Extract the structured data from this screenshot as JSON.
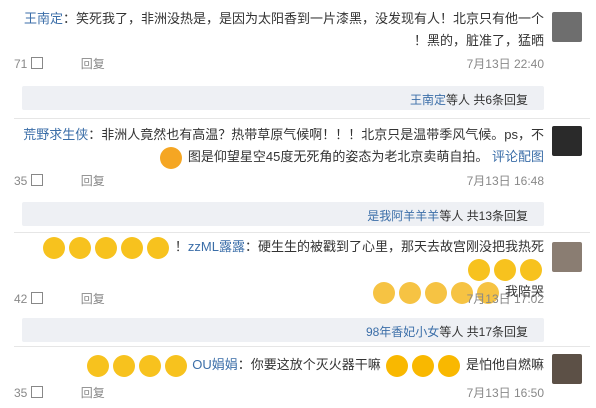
{
  "comments": [
    {
      "name": "王南定",
      "text": "：笑死我了，非洲没热是，是因为太阳香到一片漆黑，没发现有人！北京只有他一个黑的，脏准了，猛晒！",
      "time": "7月13日 22:40",
      "likes": "71",
      "reply": "回复"
    },
    {
      "name": "荒野求生侠",
      "text": "：非洲人竟然也有高温？热带草原气候啊！！！北京只是温带季风气候。ps，不图是仰望星空45度无死角的姿态为老北京卖萌自拍。",
      "time": "7月13日 16:48",
      "likes": "35",
      "reply": "回复",
      "pic": "评论配图"
    },
    {
      "name": "zzML露露",
      "text": "：硬生生的被戳到了心里，那天去故宫刚没把我热死！",
      "text2": "我陪哭",
      "time": "7月13日 17:02",
      "likes": "42",
      "reply": "回复"
    },
    {
      "name": "OU娟娟",
      "text": "：你要这放个灭火器干嘛",
      "text2": "是怕他自燃嘛",
      "time": "7月13日 16:50",
      "likes": "35",
      "reply": "回复"
    }
  ],
  "reply_bars": [
    {
      "user": "王南定",
      "label": "等人 共6条回复"
    },
    {
      "user": "是我阿羊羊羊",
      "label": "等人 共13条回复"
    },
    {
      "user": "98年香妃小女",
      "label": "等人 共17条回复"
    }
  ]
}
